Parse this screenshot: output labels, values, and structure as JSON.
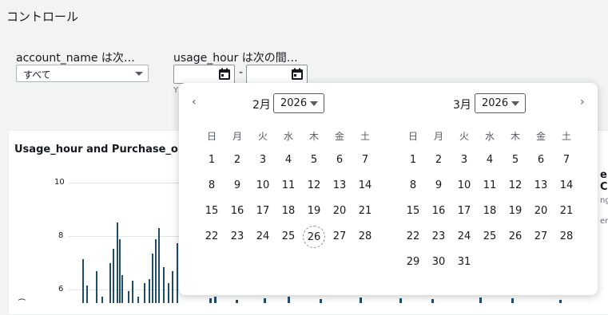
{
  "page": {
    "title": "コントロール"
  },
  "controls": {
    "account": {
      "label": "account_name は次…",
      "value": "すべて"
    },
    "usage": {
      "label": "usage_hour は次の間…",
      "separator": "-",
      "hint": "Y"
    }
  },
  "chart": {
    "title": "Usage_hour and Purchase_option",
    "yticks": [
      "10",
      "8",
      "6"
    ],
    "ylabel_fragment": ")"
  },
  "side_fragments": [
    "e C",
    "ng",
    "en"
  ],
  "calendar": {
    "prev_icon": "‹",
    "next_icon": "›",
    "weekdays": [
      "日",
      "月",
      "火",
      "水",
      "木",
      "金",
      "土"
    ],
    "months": [
      {
        "label": "2月",
        "year": "2026",
        "start_offset": 0,
        "days": 28,
        "today": 26
      },
      {
        "label": "3月",
        "year": "2026",
        "start_offset": 0,
        "days": 31,
        "today": null
      }
    ]
  },
  "colors": {
    "bar": "#1f4e6b",
    "accent": "#0073bb"
  }
}
